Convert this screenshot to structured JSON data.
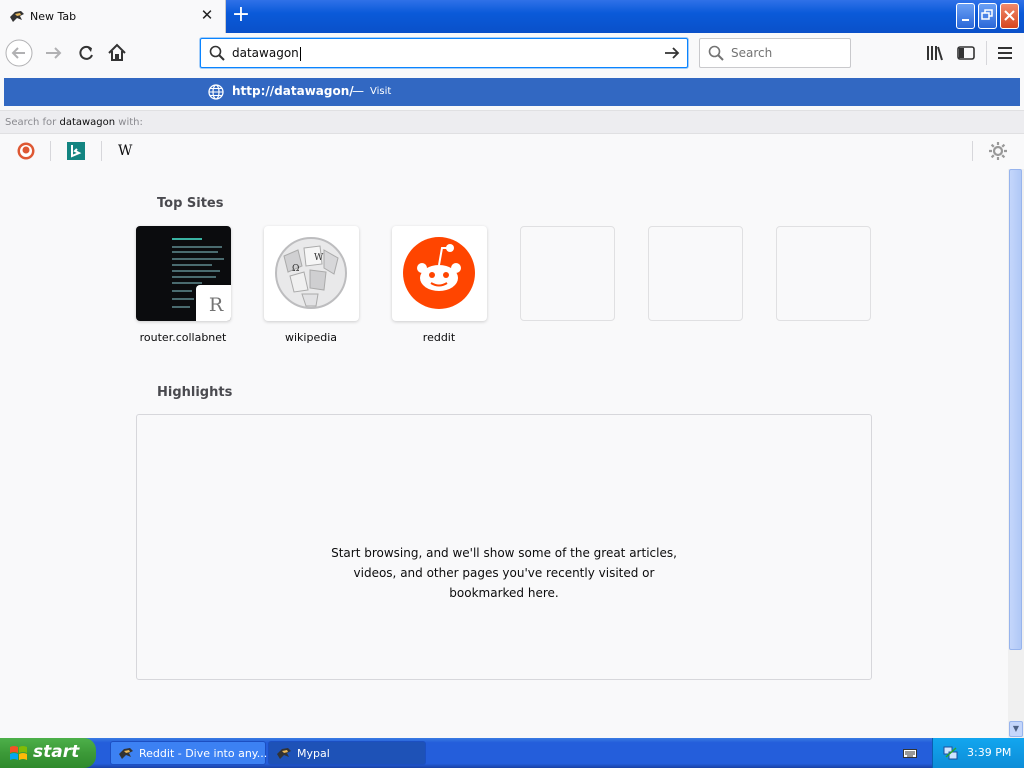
{
  "tab": {
    "title": "New Tab",
    "close": "✕",
    "new_tab": "+"
  },
  "toolbar": {
    "url_value": "datawagon",
    "search_placeholder": "Search"
  },
  "suggestion": {
    "url": "http://datawagon/",
    "dash": "—",
    "action": "Visit"
  },
  "search_for": {
    "prefix": "Search for ",
    "query": "datawagon",
    "suffix": " with:"
  },
  "engines": [
    {
      "name": "duckduckgo-icon"
    },
    {
      "name": "bing-icon"
    },
    {
      "name": "wikipedia-icon",
      "glyph": "W"
    }
  ],
  "top_sites": {
    "title": "Top Sites",
    "tiles": [
      {
        "label": "router.collabnet",
        "letter": "R"
      },
      {
        "label": "wikipedia"
      },
      {
        "label": "reddit"
      }
    ]
  },
  "highlights": {
    "title": "Highlights",
    "empty_line1": "Start browsing, and we'll show some of the great articles,",
    "empty_line2": "videos, and other pages you've recently visited or",
    "empty_line3": "bookmarked here."
  },
  "taskbar": {
    "start": "start",
    "tasks": [
      {
        "label": "Reddit - Dive into any..."
      },
      {
        "label": "Mypal"
      }
    ],
    "clock": "3:39 PM"
  },
  "colors": {
    "accent": "#0a84ff",
    "selection": "#3268c2",
    "reddit": "#ff4500"
  }
}
